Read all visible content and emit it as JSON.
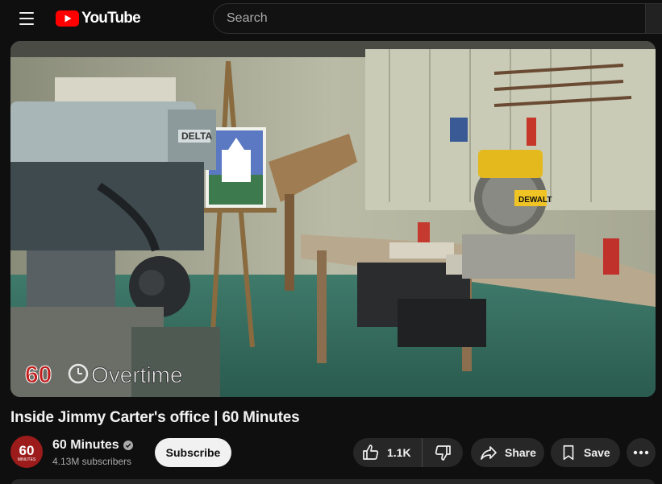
{
  "header": {
    "logo_text": "YouTube",
    "search_placeholder": "Search"
  },
  "video": {
    "overlay_logo": "60",
    "overlay_text": "Overtime",
    "machine_label": "DELTA",
    "saw_label": "DEWALT"
  },
  "title": "Inside Jimmy Carter's office | 60 Minutes",
  "channel": {
    "name": "60 Minutes",
    "subscribers": "4.13M subscribers",
    "avatar_text": "60",
    "avatar_sub": "MINUTES"
  },
  "actions": {
    "subscribe": "Subscribe",
    "likes": "1.1K",
    "share": "Share",
    "save": "Save"
  },
  "colors": {
    "background": "#0f0f0f",
    "brand_red": "#ff0000",
    "pill": "#272727"
  }
}
